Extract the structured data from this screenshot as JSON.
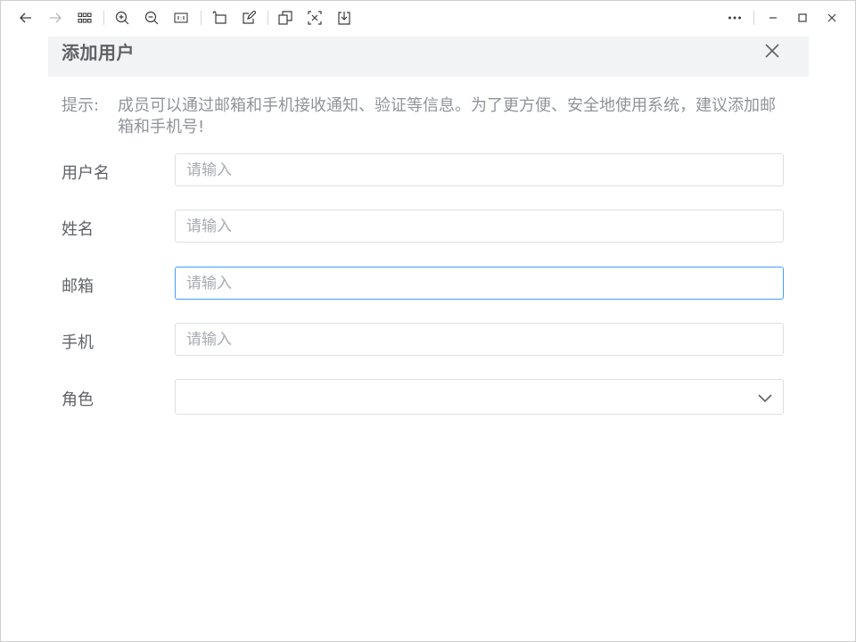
{
  "toolbar": {
    "icons": [
      "back-arrow-icon",
      "forward-arrow-icon",
      "grid-icon",
      "zoom-in-icon",
      "zoom-out-icon",
      "actual-size-icon",
      "rotate-icon",
      "edit-icon",
      "copy-icon",
      "ocr-icon",
      "download-icon",
      "more-icon",
      "minimize-icon",
      "maximize-icon",
      "close-icon"
    ]
  },
  "dialog": {
    "title": "添加用户",
    "hint_label": "提示:",
    "hint_text": "成员可以通过邮箱和手机接收通知、验证等信息。为了更方便、安全地使用系统，建议添加邮箱和手机号!"
  },
  "form": {
    "fields": [
      {
        "label": "用户名",
        "placeholder": "请输入",
        "value": ""
      },
      {
        "label": "姓名",
        "placeholder": "请输入",
        "value": ""
      },
      {
        "label": "邮箱",
        "placeholder": "请输入",
        "value": ""
      },
      {
        "label": "手机",
        "placeholder": "请输入",
        "value": ""
      }
    ],
    "role": {
      "label": "角色",
      "value": ""
    }
  },
  "colors": {
    "accent": "#409eff",
    "header_bg": "#f2f3f5",
    "label": "#606266",
    "hint": "#909399"
  }
}
